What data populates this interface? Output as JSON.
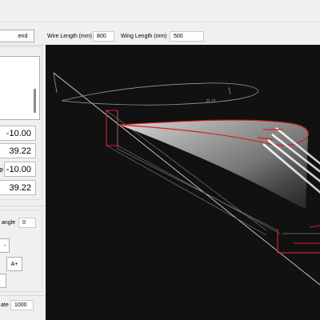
{
  "toolbar": {
    "partial_button_label": "end",
    "wire_length_label": "Wire Length (mm)",
    "wire_length_value": "800",
    "wing_length_label": "Wing Length (mm)",
    "wing_length_value": "500"
  },
  "left_panel": {
    "fields": [
      "-10.00",
      "39.22",
      "-10.00",
      "39.22"
    ],
    "field_prefixes": [
      "",
      "",
      "e",
      ""
    ],
    "angle_label": "angle",
    "angle_value": "0",
    "button_minus": "-",
    "button_a_plus": "A+",
    "rate_label": "ate",
    "rate_value": "1000"
  },
  "colors": {
    "viewport_bg": "#111111",
    "edge_red": "#d42020",
    "wire_gray": "#9a9a9a"
  }
}
